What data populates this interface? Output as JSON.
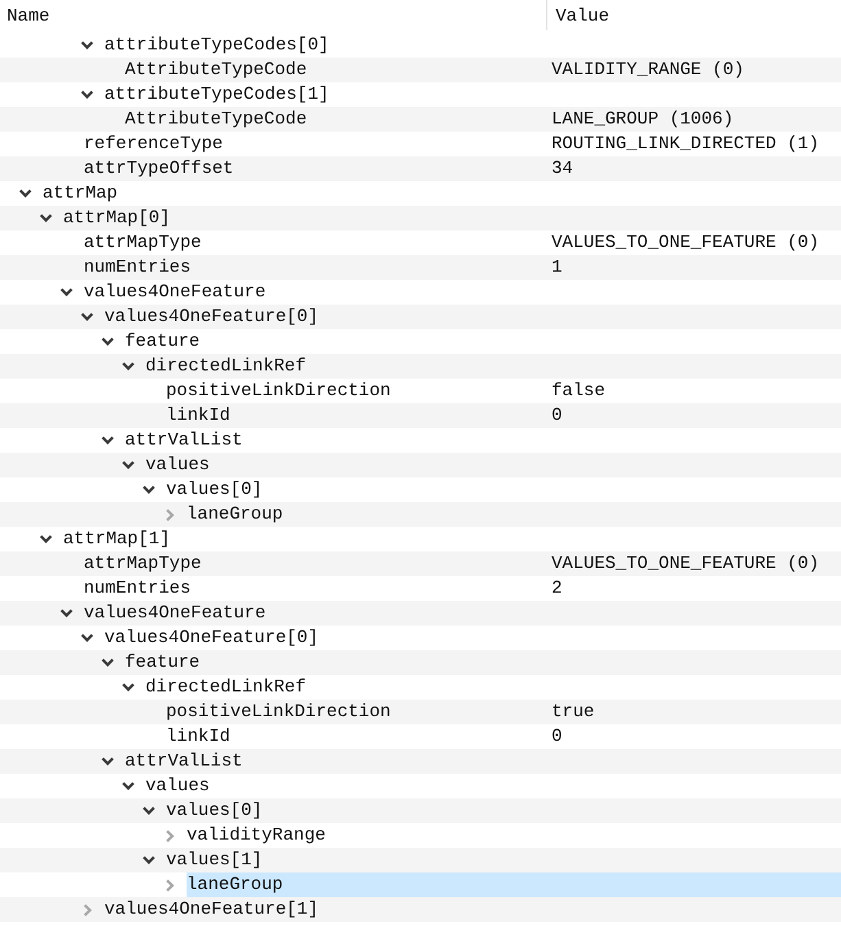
{
  "columns": [
    "Name",
    "Value"
  ],
  "tree": [
    {
      "children": [
        {
          "children": [
            {
              "children": [
                {
                  "name": "attributeTypeCodes[0]",
                  "expanded": true,
                  "selected": false,
                  "children": [
                    {
                      "name": "AttributeTypeCode",
                      "value": "VALIDITY_RANGE (0)",
                      "selected": false
                    }
                  ]
                },
                {
                  "name": "attributeTypeCodes[1]",
                  "expanded": true,
                  "selected": false,
                  "children": [
                    {
                      "name": "AttributeTypeCode",
                      "value": "LANE_GROUP (1006)",
                      "selected": false
                    }
                  ]
                }
              ]
            },
            {
              "name": "referenceType",
              "value": "ROUTING_LINK_DIRECTED (1)",
              "selected": false
            },
            {
              "name": "attrTypeOffset",
              "value": "34",
              "selected": false
            }
          ]
        }
      ]
    },
    {
      "name": "attrMap",
      "expanded": true,
      "selected": false,
      "children": [
        {
          "name": "attrMap[0]",
          "expanded": true,
          "selected": false,
          "children": [
            {
              "name": "attrMapType",
              "value": "VALUES_TO_ONE_FEATURE (0)",
              "selected": false
            },
            {
              "name": "numEntries",
              "value": "1",
              "selected": false
            },
            {
              "name": "values4OneFeature",
              "expanded": true,
              "selected": false,
              "children": [
                {
                  "name": "values4OneFeature[0]",
                  "expanded": true,
                  "selected": false,
                  "children": [
                    {
                      "name": "feature",
                      "expanded": true,
                      "selected": false,
                      "children": [
                        {
                          "name": "directedLinkRef",
                          "expanded": true,
                          "selected": false,
                          "children": [
                            {
                              "name": "positiveLinkDirection",
                              "value": "false",
                              "selected": false
                            },
                            {
                              "name": "linkId",
                              "value": "0",
                              "selected": false
                            }
                          ]
                        }
                      ]
                    },
                    {
                      "name": "attrValList",
                      "expanded": true,
                      "selected": false,
                      "children": [
                        {
                          "name": "values",
                          "expanded": true,
                          "selected": false,
                          "children": [
                            {
                              "name": "values[0]",
                              "expanded": true,
                              "selected": false,
                              "children": [
                                {
                                  "name": "laneGroup",
                                  "expanded": false,
                                  "selected": false
                                }
                              ]
                            }
                          ]
                        }
                      ]
                    }
                  ]
                }
              ]
            }
          ]
        },
        {
          "name": "attrMap[1]",
          "expanded": true,
          "selected": false,
          "children": [
            {
              "name": "attrMapType",
              "value": "VALUES_TO_ONE_FEATURE (0)",
              "selected": false
            },
            {
              "name": "numEntries",
              "value": "2",
              "selected": false
            },
            {
              "name": "values4OneFeature",
              "expanded": true,
              "selected": false,
              "children": [
                {
                  "name": "values4OneFeature[0]",
                  "expanded": true,
                  "selected": false,
                  "children": [
                    {
                      "name": "feature",
                      "expanded": true,
                      "selected": false,
                      "children": [
                        {
                          "name": "directedLinkRef",
                          "expanded": true,
                          "selected": false,
                          "children": [
                            {
                              "name": "positiveLinkDirection",
                              "value": "true",
                              "selected": false
                            },
                            {
                              "name": "linkId",
                              "value": "0",
                              "selected": false
                            }
                          ]
                        }
                      ]
                    },
                    {
                      "name": "attrValList",
                      "expanded": true,
                      "selected": false,
                      "children": [
                        {
                          "name": "values",
                          "expanded": true,
                          "selected": false,
                          "children": [
                            {
                              "name": "values[0]",
                              "expanded": true,
                              "selected": false,
                              "children": [
                                {
                                  "name": "validityRange",
                                  "expanded": false,
                                  "selected": false
                                }
                              ]
                            },
                            {
                              "name": "values[1]",
                              "expanded": true,
                              "selected": false,
                              "children": [
                                {
                                  "name": "laneGroup",
                                  "expanded": false,
                                  "selected": true
                                }
                              ]
                            }
                          ]
                        }
                      ]
                    }
                  ]
                },
                {
                  "name": "values4OneFeature[1]",
                  "expanded": false,
                  "selected": false
                }
              ]
            }
          ]
        }
      ]
    }
  ]
}
